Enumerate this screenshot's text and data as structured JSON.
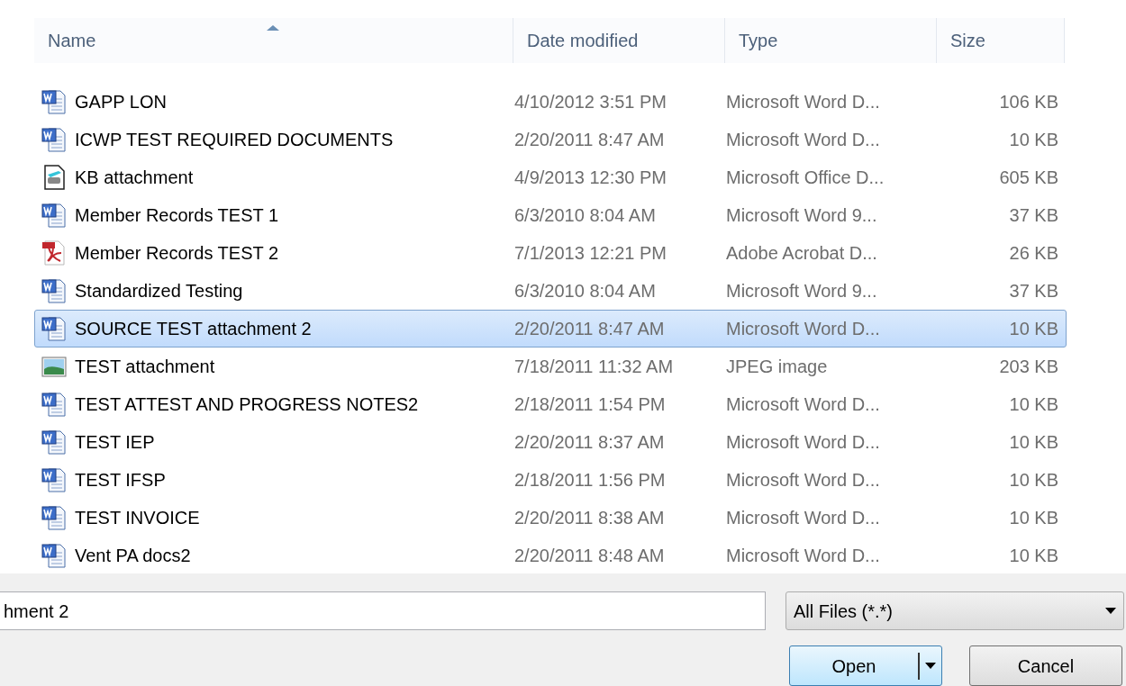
{
  "columns": [
    "Name",
    "Date modified",
    "Type",
    "Size"
  ],
  "files": [
    {
      "kind": "word",
      "name": "GAPP LON",
      "date": "4/10/2012 3:51 PM",
      "type": "Microsoft Word D...",
      "size": "106 KB",
      "selected": false
    },
    {
      "kind": "word",
      "name": "ICWP TEST REQUIRED DOCUMENTS",
      "date": "2/20/2011 8:47 AM",
      "type": "Microsoft Word D...",
      "size": "10 KB",
      "selected": false
    },
    {
      "kind": "scan",
      "name": "KB attachment",
      "date": "4/9/2013 12:30 PM",
      "type": "Microsoft Office D...",
      "size": "605 KB",
      "selected": false
    },
    {
      "kind": "word",
      "name": "Member Records TEST 1",
      "date": "6/3/2010 8:04 AM",
      "type": "Microsoft Word 9...",
      "size": "37 KB",
      "selected": false
    },
    {
      "kind": "pdf",
      "name": "Member Records TEST 2",
      "date": "7/1/2013 12:21 PM",
      "type": "Adobe Acrobat D...",
      "size": "26 KB",
      "selected": false
    },
    {
      "kind": "word",
      "name": "Standardized Testing",
      "date": "6/3/2010 8:04 AM",
      "type": "Microsoft Word 9...",
      "size": "37 KB",
      "selected": false
    },
    {
      "kind": "word",
      "name": "SOURCE TEST attachment 2",
      "date": "2/20/2011 8:47 AM",
      "type": "Microsoft Word D...",
      "size": "10 KB",
      "selected": true
    },
    {
      "kind": "image",
      "name": "TEST attachment",
      "date": "7/18/2011 11:32 AM",
      "type": "JPEG image",
      "size": "203 KB",
      "selected": false
    },
    {
      "kind": "word",
      "name": "TEST ATTEST AND PROGRESS NOTES2",
      "date": "2/18/2011 1:54 PM",
      "type": "Microsoft Word D...",
      "size": "10 KB",
      "selected": false
    },
    {
      "kind": "word",
      "name": "TEST IEP",
      "date": "2/20/2011 8:37 AM",
      "type": "Microsoft Word D...",
      "size": "10 KB",
      "selected": false
    },
    {
      "kind": "word",
      "name": "TEST IFSP",
      "date": "2/18/2011 1:56 PM",
      "type": "Microsoft Word D...",
      "size": "10 KB",
      "selected": false
    },
    {
      "kind": "word",
      "name": "TEST INVOICE",
      "date": "2/20/2011 8:38 AM",
      "type": "Microsoft Word D...",
      "size": "10 KB",
      "selected": false
    },
    {
      "kind": "word",
      "name": "Vent PA docs2",
      "date": "2/20/2011 8:48 AM",
      "type": "Microsoft Word D...",
      "size": "10 KB",
      "selected": false
    }
  ],
  "filename": {
    "value": "hment 2"
  },
  "filter": {
    "value": "All Files (*.*)"
  },
  "buttons": {
    "open": "Open",
    "cancel": "Cancel"
  }
}
